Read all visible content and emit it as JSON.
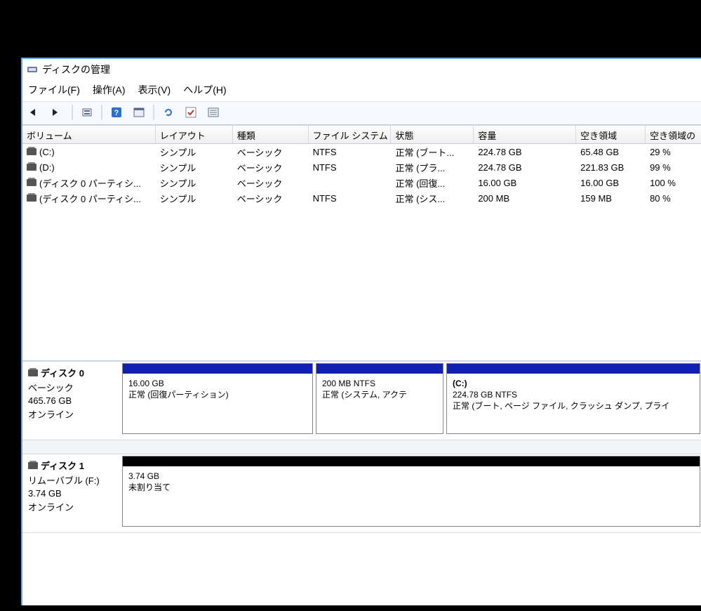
{
  "window": {
    "title": "ディスクの管理"
  },
  "menu": {
    "file": "ファイル(F)",
    "action": "操作(A)",
    "view": "表示(V)",
    "help": "ヘルプ(H)"
  },
  "columns": {
    "volume": "ボリューム",
    "layout": "レイアウト",
    "kind": "種類",
    "filesystem": "ファイル システム",
    "status": "状態",
    "capacity": "容量",
    "free": "空き領域",
    "free_pct": "空き領域の"
  },
  "volumes": [
    {
      "name": "(C:)",
      "layout": "シンプル",
      "kind": "ベーシック",
      "fs": "NTFS",
      "status": "正常 (ブート...",
      "cap": "224.78 GB",
      "free": "65.48 GB",
      "pct": "29 %"
    },
    {
      "name": "(D:)",
      "layout": "シンプル",
      "kind": "ベーシック",
      "fs": "NTFS",
      "status": "正常 (プラ...",
      "cap": "224.78 GB",
      "free": "221.83 GB",
      "pct": "99 %"
    },
    {
      "name": "(ディスク 0 パーティシ...",
      "layout": "シンプル",
      "kind": "ベーシック",
      "fs": "",
      "status": "正常 (回復...",
      "cap": "16.00 GB",
      "free": "16.00 GB",
      "pct": "100 %"
    },
    {
      "name": "(ディスク 0 パーティシ...",
      "layout": "シンプル",
      "kind": "ベーシック",
      "fs": "NTFS",
      "status": "正常 (シス...",
      "cap": "200 MB",
      "free": "159 MB",
      "pct": "80 %"
    }
  ],
  "disks": [
    {
      "label": "ディスク 0",
      "type": "ベーシック",
      "size": "465.76 GB",
      "state": "オンライン",
      "parts": [
        {
          "title": "",
          "line1": "16.00 GB",
          "line2": "正常 (回復パーティション)",
          "head": "blue",
          "grow": 3
        },
        {
          "title": "",
          "line1": "200 MB NTFS",
          "line2": "正常 (システム, アクテ",
          "head": "blue",
          "grow": 2
        },
        {
          "title": "(C:)",
          "line1": "224.78 GB NTFS",
          "line2": "正常 (ブート, ページ ファイル, クラッシュ ダンプ, プライ",
          "head": "blue",
          "grow": 4
        }
      ]
    },
    {
      "label": "ディスク 1",
      "type": "リムーバブル (F:)",
      "size": "3.74 GB",
      "state": "オンライン",
      "parts": [
        {
          "title": "",
          "line1": "3.74 GB",
          "line2": "未割り当て",
          "head": "black",
          "grow": 1
        }
      ]
    }
  ]
}
